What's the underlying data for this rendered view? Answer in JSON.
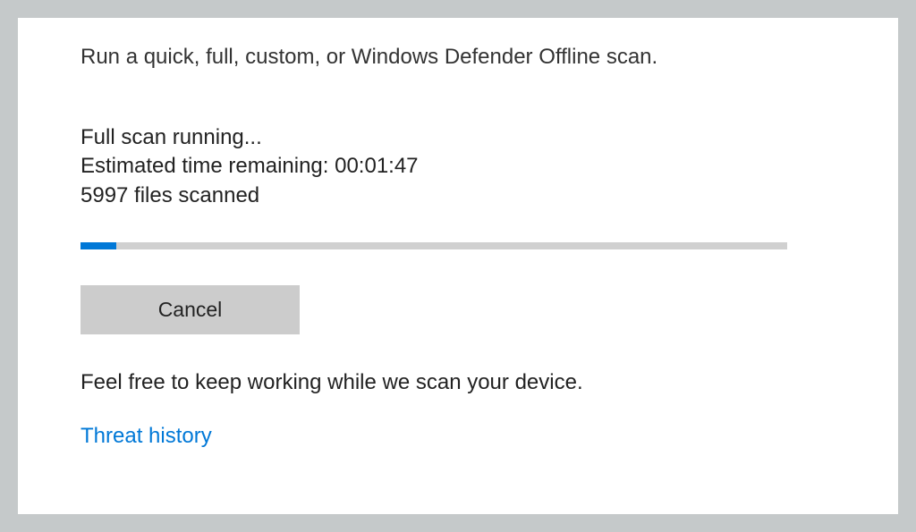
{
  "header": {
    "description": "Run a quick, full, custom, or Windows Defender Offline scan."
  },
  "scan": {
    "status": "Full scan running...",
    "eta_label": "Estimated time remaining: ",
    "eta_value": "00:01:47",
    "files_count": "5997",
    "files_suffix": "  files scanned",
    "progress_percent": 5
  },
  "actions": {
    "cancel_label": "Cancel"
  },
  "info": {
    "message": "Feel free to keep working while we scan your device."
  },
  "links": {
    "threat_history": "Threat history"
  }
}
